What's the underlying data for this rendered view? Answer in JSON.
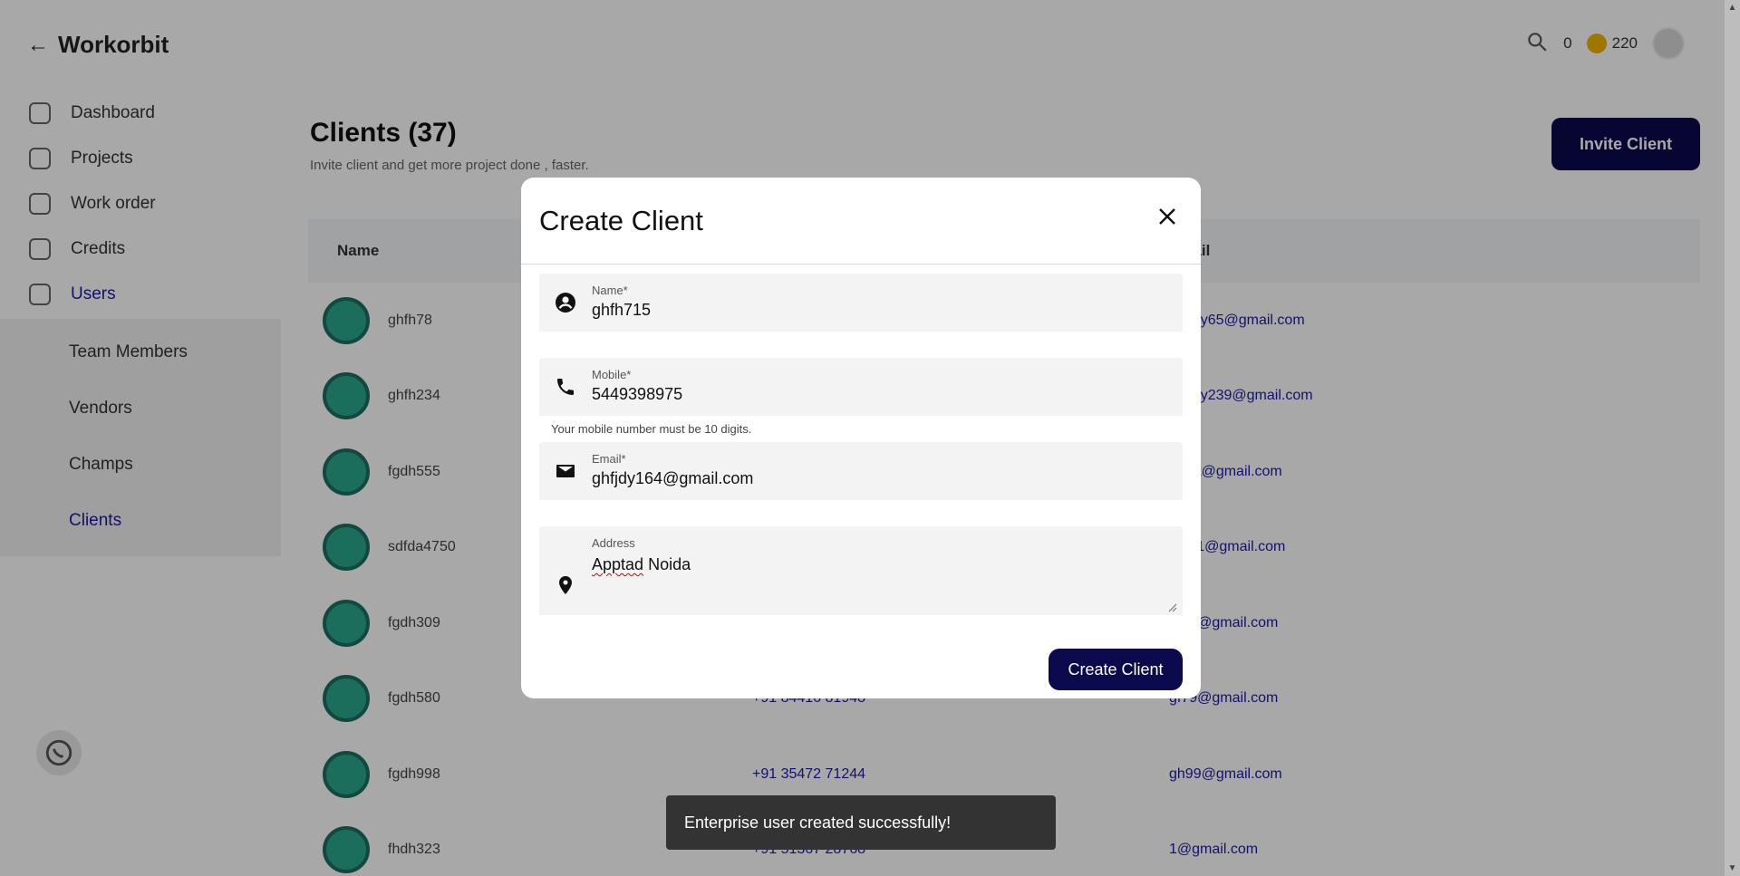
{
  "app": {
    "brand": "Workorbit",
    "credits_balance": "0",
    "coins_balance": "220"
  },
  "sidebar": {
    "items": [
      {
        "label": "Dashboard"
      },
      {
        "label": "Projects"
      },
      {
        "label": "Work order"
      },
      {
        "label": "Credits"
      },
      {
        "label": "Users"
      }
    ],
    "sub_items": [
      {
        "label": "Team Members"
      },
      {
        "label": "Vendors"
      },
      {
        "label": "Champs"
      },
      {
        "label": "Clients"
      }
    ]
  },
  "main": {
    "title": "Clients (37)",
    "subtitle": "Invite client and get more project done , faster.",
    "invite_button": "Invite Client",
    "columns": [
      "Name",
      "",
      "Email"
    ],
    "rows": [
      {
        "name": "ghfh78",
        "mobile": "",
        "email": "ghfjdy65@gmail.com"
      },
      {
        "name": "ghfh234",
        "mobile": "",
        "email": "ghfjdy239@gmail.com"
      },
      {
        "name": "fgdh555",
        "mobile": "",
        "email": "gh5ft@gmail.com"
      },
      {
        "name": "sdfda4750",
        "mobile": "",
        "email": "sgt61@gmail.com"
      },
      {
        "name": "fgdh309",
        "mobile": "",
        "email": "gf79@gmail.com"
      },
      {
        "name": "fgdh580",
        "mobile": "+91 84416 81948",
        "email": "gf79@gmail.com"
      },
      {
        "name": "fgdh998",
        "mobile": "+91 35472 71244",
        "email": "gh99@gmail.com"
      },
      {
        "name": "fhdh323",
        "mobile": "+91 51367 28768",
        "email": "1@gmail.com"
      }
    ]
  },
  "modal": {
    "title": "Create Client",
    "fields": {
      "name": {
        "label": "Name*",
        "value": "ghfh715"
      },
      "mobile": {
        "label": "Mobile*",
        "value": "5449398975",
        "helper": "Your mobile number must be 10 digits."
      },
      "email": {
        "label": "Email*",
        "value": "ghfjdy164@gmail.com"
      },
      "address": {
        "label": "Address",
        "value_word1": "Apptad",
        "value_word2": " Noida"
      }
    },
    "submit_label": "Create Client"
  },
  "toast": {
    "message": "Enterprise user created successfully!"
  },
  "colors": {
    "primary": "#0b0a4d",
    "accent_link": "#1b1aa6",
    "toast_bg": "#333333",
    "field_bg": "#f3f3f3"
  },
  "icons": [
    "back-arrow-icon",
    "phone-search-icon",
    "coin-icon",
    "account-circle-icon",
    "phone-icon",
    "mail-icon",
    "location-pin-icon",
    "close-icon",
    "whatsapp-icon"
  ]
}
